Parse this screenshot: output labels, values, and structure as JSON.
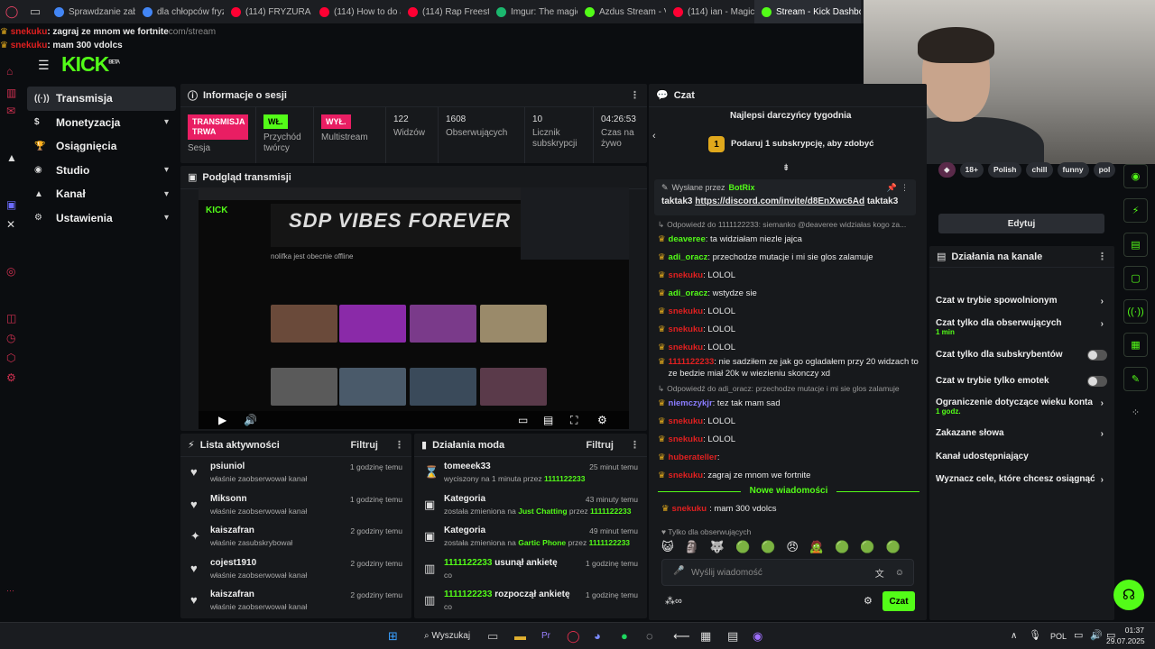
{
  "tabs": [
    {
      "label": "Sprawdzanie zabe",
      "color": "#4285f4"
    },
    {
      "label": "dla chłopców fryz",
      "color": "#4285f4"
    },
    {
      "label": "(114) FRYZURA TI",
      "color": "#ff0033"
    },
    {
      "label": "(114) How to do a",
      "color": "#ff0033"
    },
    {
      "label": "(114) Rap Freesty",
      "color": "#ff0033"
    },
    {
      "label": "Imgur: The magic",
      "color": "#1bb76e"
    },
    {
      "label": "Azdus Stream - V",
      "color": "#53fc18"
    },
    {
      "label": "(114) ian - Magic",
      "color": "#ff0033"
    },
    {
      "label": "Stream - Kick Dashbo",
      "color": "#53fc18",
      "active": true
    }
  ],
  "overlay": {
    "line1_user": "snekuku",
    "line1_text": ": zagraj ze mnom we fortnite",
    "url_tail": "com/stream",
    "line2_user": "snekuku",
    "line2_text": ": mam 300 vdolcs"
  },
  "logo": "KICK",
  "logo_sup": "BETA",
  "sidebar": [
    {
      "label": "Transmisja",
      "icon": "((·))",
      "active": true,
      "chev": false
    },
    {
      "label": "Monetyzacja",
      "icon": "$",
      "chev": true
    },
    {
      "label": "Osiągnięcia",
      "icon": "🏆",
      "chev": false
    },
    {
      "label": "Studio",
      "icon": "◉",
      "chev": true
    },
    {
      "label": "Kanał",
      "icon": "▲",
      "chev": true
    },
    {
      "label": "Ustawienia",
      "icon": "⚙",
      "chev": true
    }
  ],
  "session": {
    "title": "Informacje o sesji",
    "live_tag": "TRANSMISJA TRWA",
    "live_label": "Sesja",
    "creator_tag": "WŁ.",
    "creator_label": "Przychód twórcy",
    "multi_tag": "WYŁ.",
    "multi_label": "Multistream",
    "viewers": "122",
    "viewers_label": "Widzów",
    "followers": "1608",
    "followers_label": "Obserwujących",
    "subs": "10",
    "subs_label": "Licznik subskrypcji",
    "time": "04:26:53",
    "time_label": "Czas na żywo"
  },
  "preview": {
    "title": "Podgląd transmisji",
    "banner": "SDP VIBES FOREVER",
    "offline_note": "nolifka jest obecnie offline"
  },
  "activity": {
    "title": "Lista aktywności",
    "filter": "Filtruj",
    "rows": [
      {
        "icon": "♥",
        "name": "psiuniol",
        "sub": "właśnie zaobserwował kanał",
        "time": "1 godzinę temu"
      },
      {
        "icon": "♥",
        "name": "Miksonn",
        "sub": "właśnie zaobserwował kanał",
        "time": "1 godzinę temu"
      },
      {
        "icon": "✦",
        "name": "kaiszafran",
        "sub": "właśnie zasubskrybował",
        "time": "2 godziny temu"
      },
      {
        "icon": "♥",
        "name": "cojest1910",
        "sub": "właśnie zaobserwował kanał",
        "time": "2 godziny temu"
      },
      {
        "icon": "♥",
        "name": "kaiszafran",
        "sub": "właśnie zaobserwował kanał",
        "time": "2 godziny temu"
      }
    ]
  },
  "modact": {
    "title": "Działania moda",
    "filter": "Filtruj",
    "rows": [
      {
        "icon": "⌛",
        "name": "tomeeek33",
        "sub_a": "wyciszony na 1 minuta przez ",
        "sub_b": "",
        "sub_c": "1111122233",
        "time": "25 minut temu"
      },
      {
        "icon": "▣",
        "name": "Kategoria",
        "sub_a": "została zmieniona na ",
        "sub_b": "Just Chatting",
        "sub_mid": " przez ",
        "sub_c": "1111122233",
        "time": "43 minuty temu"
      },
      {
        "icon": "▣",
        "name": "Kategoria",
        "sub_a": "została zmieniona na ",
        "sub_b": "Gartic Phone",
        "sub_mid": " przez ",
        "sub_c": "1111122233",
        "time": "49 minut temu"
      },
      {
        "icon": "▥",
        "name_user": "1111122233",
        "name": " usunął ankietę",
        "sub_a": "co",
        "time": "1 godzinę temu"
      },
      {
        "icon": "▥",
        "name_user": "1111122233",
        "name": " rozpoczął ankietę",
        "sub_a": "co",
        "time": "1 godzinę temu"
      }
    ]
  },
  "chat": {
    "title": "Czat",
    "top_title": "Najlepsi darczyńcy tygodnia",
    "top_rank": "1",
    "top_text": "Podaruj 1 subskrypcję, aby zdobyć",
    "pinned_by": "Wysłane przez",
    "pinned_user": "BotRix",
    "pinned_prefix": "taktak3 ",
    "pinned_link": "https://discord.com/invite/d8EnXwc6Ad",
    "pinned_suffix": " taktak3",
    "new_messages": "Nowe wiadomości",
    "followers_only": "Tylko dla obserwujących",
    "placeholder": "Wyślij wiadomość",
    "send": "Czat",
    "messages": [
      {
        "kind": "reply",
        "text": "Odpowiedź do 1111122233: siemanko @deaveree widziałas kogo za..."
      },
      {
        "user": "deaveree",
        "ucolor": "#53fc18",
        "text": ": ta widziałam niezle jajca"
      },
      {
        "user": "adi_oracz",
        "ucolor": "#53fc18",
        "text": ": przechodze mutacje i mi sie glos zalamuje"
      },
      {
        "user": "snekuku",
        "ucolor": "#e02020",
        "text": ": LOLOL"
      },
      {
        "user": "adi_oracz",
        "ucolor": "#53fc18",
        "text": ": wstydze sie"
      },
      {
        "user": "snekuku",
        "ucolor": "#e02020",
        "text": ": LOLOL"
      },
      {
        "user": "snekuku",
        "ucolor": "#e02020",
        "text": ": LOLOL"
      },
      {
        "user": "snekuku",
        "ucolor": "#e02020",
        "text": ": LOLOL"
      },
      {
        "kind": "two",
        "user": "1111122233",
        "ucolor": "#e02020",
        "text": ": nie sadziłem ze jak go ogladałem przy 20 widzach to ze bedzie miał 20k w wiezieniu skonczy xd"
      },
      {
        "kind": "reply",
        "text": "Odpowiedź do adi_oracz: przechodze mutacje i mi sie glos zalamuje"
      },
      {
        "user": "niemczykjr",
        "ucolor": "#8a7cff",
        "text": ": tez tak mam sad"
      },
      {
        "user": "snekuku",
        "ucolor": "#e02020",
        "text": ": LOLOL"
      },
      {
        "user": "snekuku",
        "ucolor": "#e02020",
        "text": ": LOLOL"
      },
      {
        "user": "huberateller",
        "ucolor": "#e02020",
        "text": ":"
      },
      {
        "user": "snekuku",
        "ucolor": "#e02020",
        "text": ": zagraj ze mnom we fortnite"
      }
    ],
    "last": {
      "user": "snekuku",
      "text": ": mam 300 vdolcs"
    }
  },
  "right": {
    "tags": [
      "18+",
      "Polish",
      "chill",
      "funny",
      "pol"
    ],
    "edit": "Edytuj",
    "channel_title": "Działania na kanale",
    "items": [
      {
        "label": "Czat w trybie spowolnionym",
        "type": "chev"
      },
      {
        "label": "Czat tylko dla obserwujących",
        "sub": "1 min",
        "type": "chev"
      },
      {
        "label": "Czat tylko dla subskrybentów",
        "type": "toggle"
      },
      {
        "label": "Czat w trybie tylko emotek",
        "type": "toggle"
      },
      {
        "label": "Ograniczenie dotyczące wieku konta",
        "sub": "1 godz.",
        "type": "chev"
      },
      {
        "label": "Zakazane słowa",
        "type": "chev"
      },
      {
        "label": "Kanał udostępniający",
        "type": "none"
      },
      {
        "label": "Wyznacz cele, które chcesz osiągnąć",
        "type": "chev"
      }
    ]
  },
  "taskbar": {
    "search": "Wyszukaj",
    "lang": "POL",
    "time": "01:37",
    "date": "29.07.2025"
  },
  "colors": {
    "accent": "#53fc18",
    "live": "#e91e63",
    "panel": "#17191c"
  }
}
